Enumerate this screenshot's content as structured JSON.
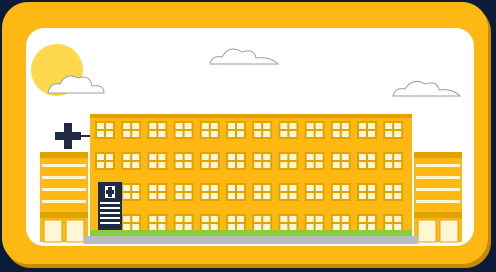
{
  "scene": {
    "subject": "hospital-building",
    "colors": {
      "background": "#0d1b3a",
      "frame": "#fdb813",
      "frame_shadow": "#c98a00",
      "sky": "#ffffff",
      "sun": "#fdd84c",
      "building": "#fdb813",
      "building_dark": "#e2a300",
      "window_pane": "#fff6d6",
      "cross": "#1f2a44",
      "grass": "#8ccc3c",
      "pavement": "#b8bcc2"
    },
    "icons": [
      "sun-icon",
      "cloud-icon",
      "medical-cross-icon"
    ]
  }
}
